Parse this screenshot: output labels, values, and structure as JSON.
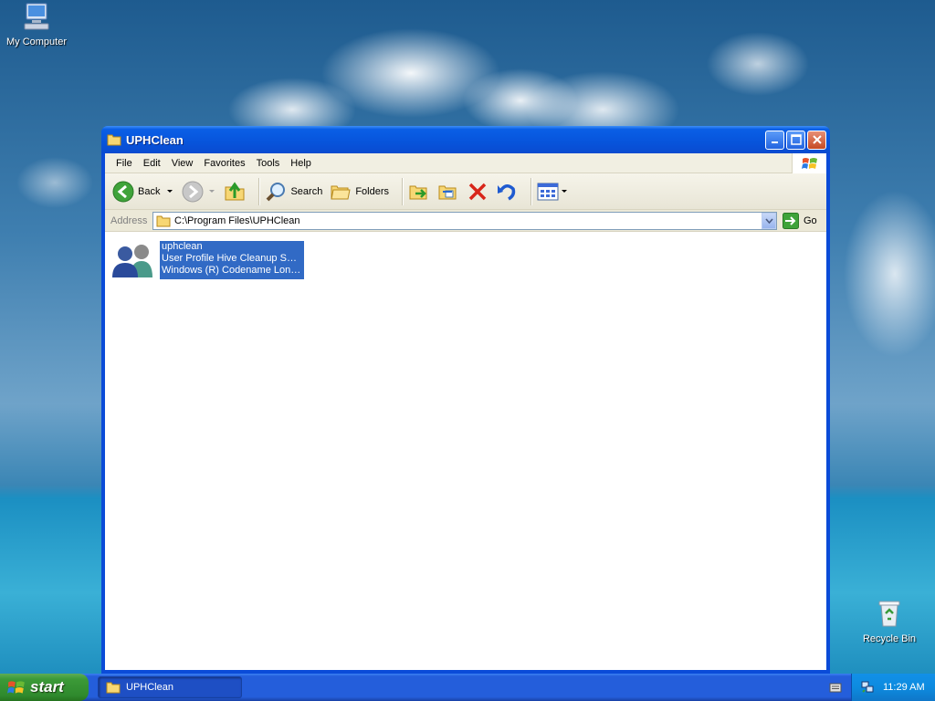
{
  "desktop": {
    "icons": [
      {
        "label": "My Computer",
        "icon": "my-computer-icon"
      },
      {
        "label": "Recycle Bin",
        "icon": "recycle-bin-icon"
      }
    ]
  },
  "window": {
    "title": "UPHClean",
    "menu": [
      "File",
      "Edit",
      "View",
      "Favorites",
      "Tools",
      "Help"
    ],
    "toolbar": {
      "back_label": "Back",
      "search_label": "Search",
      "folders_label": "Folders"
    },
    "address": {
      "label": "Address",
      "value": "C:\\Program Files\\UPHClean",
      "go_label": "Go"
    },
    "files": [
      {
        "name": "uphclean",
        "description": "User Profile Hive Cleanup Serv...",
        "company": "Windows (R) Codename Long...",
        "icon": "users-icon"
      }
    ]
  },
  "taskbar": {
    "start_label": "start",
    "tasks": [
      {
        "label": "UPHClean",
        "icon": "folder-icon"
      }
    ],
    "clock": "11:29 AM"
  },
  "colors": {
    "titlebar": "#0754db",
    "selection": "#316ac5",
    "start": "#3c9a38",
    "taskbar": "#245edb"
  }
}
